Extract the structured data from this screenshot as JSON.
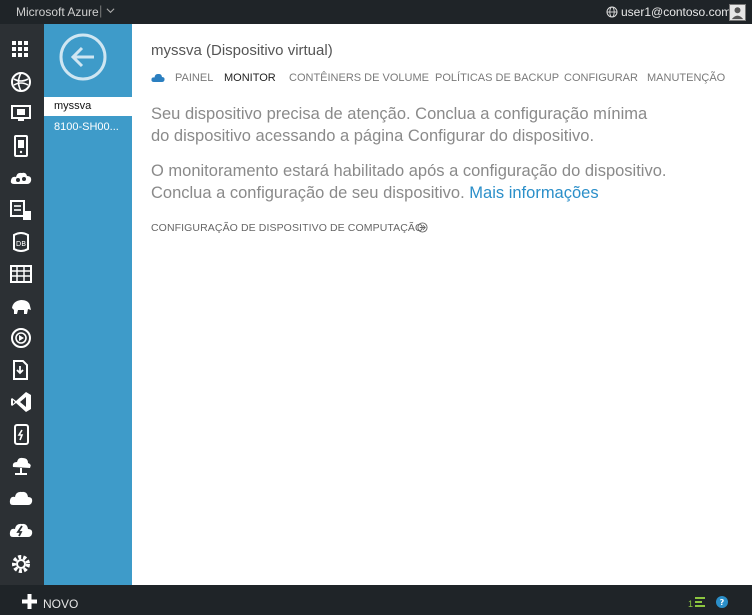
{
  "topbar": {
    "brand": "Microsoft Azure",
    "separator": "|",
    "user": "user1@contoso.com"
  },
  "nav_icons": [
    "grid-icon",
    "globe-icon",
    "monitor-icon",
    "mobile-icon",
    "cloud-services-icon",
    "document-icon",
    "database-icon",
    "table-icon",
    "hadoop-icon",
    "media-icon",
    "import-export-icon",
    "visual-studio-icon",
    "storsimple-icon",
    "network-icon",
    "cloud-icon",
    "automation-icon",
    "settings-icon"
  ],
  "panel": {
    "items": [
      {
        "label": "myssva",
        "selected": true
      },
      {
        "label": "8100-SH00..."
      }
    ]
  },
  "main": {
    "title": "myssva (Dispositivo virtual)",
    "tabs": [
      {
        "label": "PAINEL",
        "active": false
      },
      {
        "label": "MONITOR",
        "active": true
      },
      {
        "label": "CONTÊINERS DE VOLUME",
        "active": false
      },
      {
        "label": "POLÍTICAS DE BACKUP",
        "active": false
      },
      {
        "label": "CONFIGURAR",
        "active": false
      },
      {
        "label": "MANUTENÇÃO",
        "active": false
      }
    ],
    "para1_line1": "Seu dispositivo precisa de atenção. Conclua a configuração mínima",
    "para1_line2": "do dispositivo acessando a página Configurar do dispositivo.",
    "para2_line1": "O monitoramento estará habilitado após a configuração do dispositivo.",
    "para2_line2": "Conclua a configuração de seu dispositivo.",
    "more_link": "Mais informações",
    "compute_link": "CONFIGURAÇÃO DE DISPOSITIVO DE COMPUTAÇÃO"
  },
  "bottombar": {
    "new_label": "NOVO",
    "count": "1"
  },
  "colors": {
    "topbar": "#1f2428",
    "nav": "#2c3034",
    "panel": "#3e9bc9",
    "link": "#2b8fc9",
    "accent_green": "#8cc63f"
  }
}
